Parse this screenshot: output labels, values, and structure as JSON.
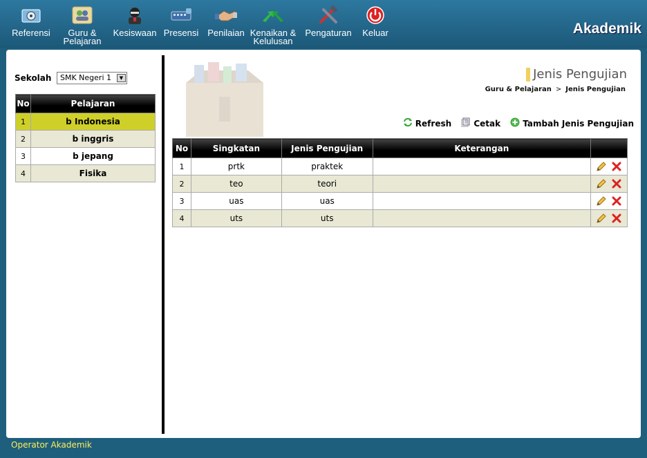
{
  "nav": {
    "items": [
      {
        "label": "Referensi",
        "icon": "referensi-icon"
      },
      {
        "label": "Guru &\nPelajaran",
        "icon": "guru-icon"
      },
      {
        "label": "Kesiswaan",
        "icon": "student-icon"
      },
      {
        "label": "Presensi",
        "icon": "presensi-icon"
      },
      {
        "label": "Penilaian",
        "icon": "handshake-icon"
      },
      {
        "label": "Kenaikan &\nKelulusan",
        "icon": "arrows-icon"
      },
      {
        "label": "Pengaturan",
        "icon": "tools-icon"
      },
      {
        "label": "Keluar",
        "icon": "power-icon"
      }
    ],
    "brand": "Akademik"
  },
  "sidebar": {
    "sekolah_label": "Sekolah",
    "sekolah_value": "SMK Negeri 1",
    "headers": [
      "No",
      "Pelajaran"
    ],
    "rows": [
      {
        "no": "1",
        "name": "b Indonesia"
      },
      {
        "no": "2",
        "name": "b inggris"
      },
      {
        "no": "3",
        "name": "b jepang"
      },
      {
        "no": "4",
        "name": "Fisika"
      }
    ]
  },
  "content": {
    "title": "Jenis Pengujian",
    "breadcrumb": [
      "Guru & Pelajaran",
      ">",
      "Jenis Pengujian"
    ],
    "actions": {
      "refresh": "Refresh",
      "cetak": "Cetak",
      "tambah": "Tambah Jenis Pengujian"
    },
    "table": {
      "headers": [
        "No",
        "Singkatan",
        "Jenis Pengujian",
        "Keterangan",
        ""
      ],
      "rows": [
        {
          "no": "1",
          "singkatan": "prtk",
          "jenis": "praktek",
          "keterangan": ""
        },
        {
          "no": "2",
          "singkatan": "teo",
          "jenis": "teori",
          "keterangan": ""
        },
        {
          "no": "3",
          "singkatan": "uas",
          "jenis": "uas",
          "keterangan": ""
        },
        {
          "no": "4",
          "singkatan": "uts",
          "jenis": "uts",
          "keterangan": ""
        }
      ]
    }
  },
  "footer": {
    "user": "Operator Akademik"
  },
  "colors": {
    "selected_row": "#cfcf2a",
    "topbar": "#2d78a0",
    "footer_text": "#ffee55"
  }
}
